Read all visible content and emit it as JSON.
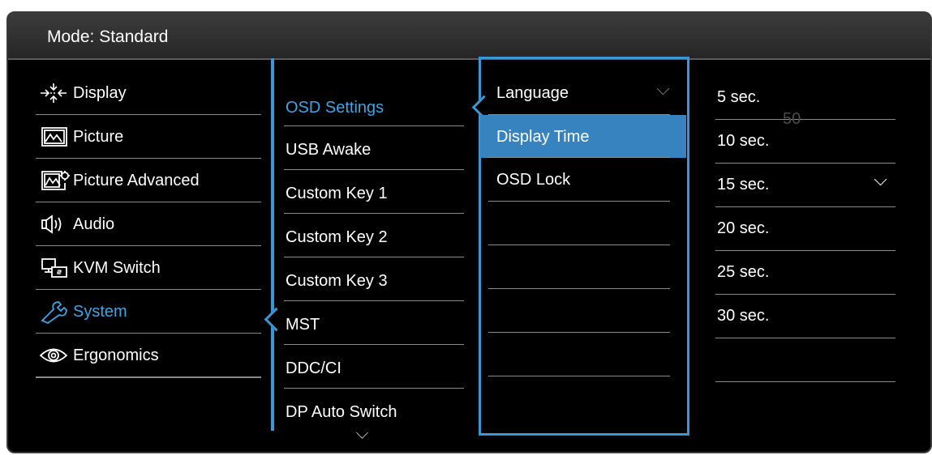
{
  "header": {
    "mode_label": "Mode: Standard"
  },
  "menu": {
    "items": [
      {
        "label": "Display",
        "icon": "display-icon"
      },
      {
        "label": "Picture",
        "icon": "picture-icon"
      },
      {
        "label": "Picture Advanced",
        "icon": "picture-advanced-icon"
      },
      {
        "label": "Audio",
        "icon": "speaker-icon"
      },
      {
        "label": "KVM Switch",
        "icon": "kvm-switch-icon"
      },
      {
        "label": "System",
        "icon": "wrench-icon",
        "selected": true
      },
      {
        "label": "Ergonomics",
        "icon": "eye-icon"
      }
    ]
  },
  "submenu": {
    "items": [
      {
        "label": "OSD Settings",
        "selected": true
      },
      {
        "label": "USB Awake"
      },
      {
        "label": "Custom Key 1"
      },
      {
        "label": "Custom Key 2"
      },
      {
        "label": "Custom Key 3"
      },
      {
        "label": "MST"
      },
      {
        "label": "DDC/CI"
      },
      {
        "label": "DP Auto Switch"
      }
    ],
    "more_icon": "chevron-down-icon"
  },
  "osd_settings": {
    "items": [
      {
        "label": "Language"
      },
      {
        "label": "Display Time",
        "highlighted": true
      },
      {
        "label": "OSD Lock"
      }
    ]
  },
  "display_time_options": {
    "items": [
      {
        "label": "5 sec."
      },
      {
        "label": "10 sec."
      },
      {
        "label": "15 sec.",
        "checked": true
      },
      {
        "label": "20 sec."
      },
      {
        "label": "25 sec."
      },
      {
        "label": "30 sec."
      }
    ],
    "ghost_value": "50"
  },
  "colors": {
    "accent": "#3a97d6",
    "highlight": "#3783bf",
    "selected_text": "#3ea5e6"
  }
}
